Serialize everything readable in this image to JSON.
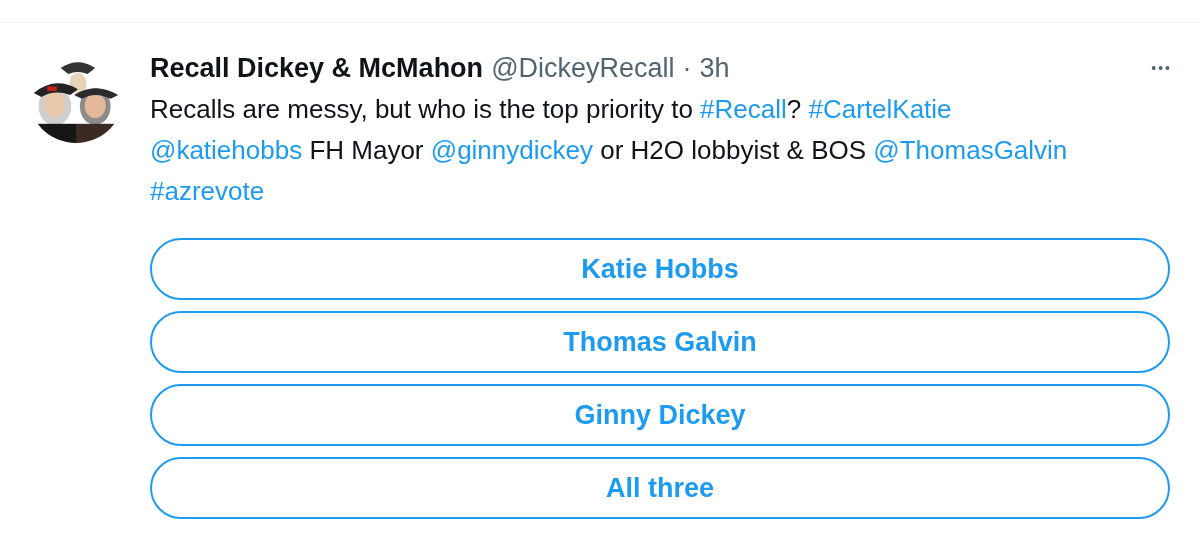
{
  "post": {
    "author": "Recall Dickey & McMahon",
    "handle": "@DickeyRecall",
    "separator": "·",
    "time": "3h",
    "more": "•••",
    "body": [
      {
        "kind": "text",
        "text": "Recalls are messy, but who is the top priority to "
      },
      {
        "kind": "link",
        "text": "#Recall"
      },
      {
        "kind": "text",
        "text": "? "
      },
      {
        "kind": "link",
        "text": "#CartelKatie"
      },
      {
        "kind": "link",
        "text": "@katiehobbs"
      },
      {
        "kind": "text",
        "text": " FH Mayor "
      },
      {
        "kind": "link",
        "text": "@ginnydickey"
      },
      {
        "kind": "text",
        "text": " or H2O lobbyist & BOS "
      },
      {
        "kind": "link",
        "text": "@ThomasGalvin"
      },
      {
        "kind": "link",
        "text": "#azrevote"
      }
    ],
    "poll": {
      "options": [
        {
          "label": "Katie Hobbs"
        },
        {
          "label": "Thomas Galvin"
        },
        {
          "label": "Ginny Dickey"
        },
        {
          "label": "All three"
        }
      ]
    }
  }
}
